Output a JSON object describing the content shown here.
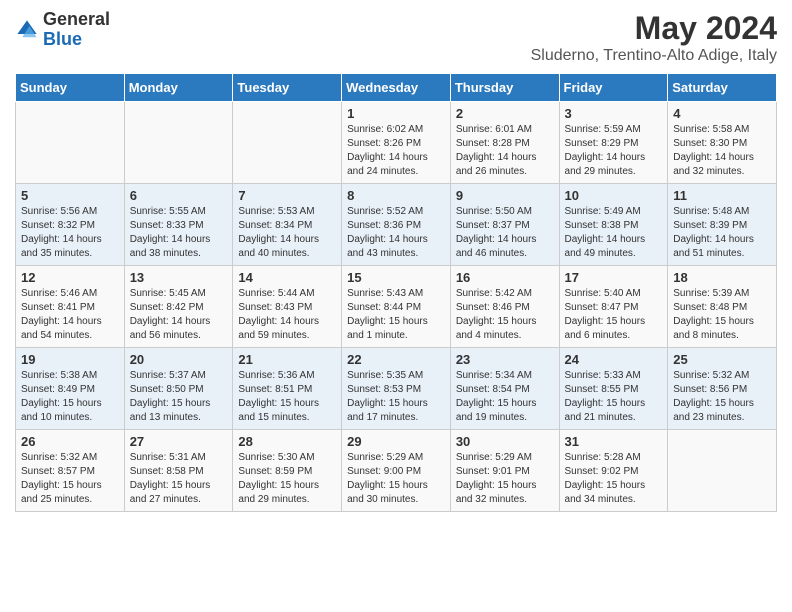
{
  "header": {
    "logo_general": "General",
    "logo_blue": "Blue",
    "month_year": "May 2024",
    "location": "Sluderno, Trentino-Alto Adige, Italy"
  },
  "days_of_week": [
    "Sunday",
    "Monday",
    "Tuesday",
    "Wednesday",
    "Thursday",
    "Friday",
    "Saturday"
  ],
  "weeks": [
    [
      {
        "day": "",
        "info": ""
      },
      {
        "day": "",
        "info": ""
      },
      {
        "day": "",
        "info": ""
      },
      {
        "day": "1",
        "info": "Sunrise: 6:02 AM\nSunset: 8:26 PM\nDaylight: 14 hours\nand 24 minutes."
      },
      {
        "day": "2",
        "info": "Sunrise: 6:01 AM\nSunset: 8:28 PM\nDaylight: 14 hours\nand 26 minutes."
      },
      {
        "day": "3",
        "info": "Sunrise: 5:59 AM\nSunset: 8:29 PM\nDaylight: 14 hours\nand 29 minutes."
      },
      {
        "day": "4",
        "info": "Sunrise: 5:58 AM\nSunset: 8:30 PM\nDaylight: 14 hours\nand 32 minutes."
      }
    ],
    [
      {
        "day": "5",
        "info": "Sunrise: 5:56 AM\nSunset: 8:32 PM\nDaylight: 14 hours\nand 35 minutes."
      },
      {
        "day": "6",
        "info": "Sunrise: 5:55 AM\nSunset: 8:33 PM\nDaylight: 14 hours\nand 38 minutes."
      },
      {
        "day": "7",
        "info": "Sunrise: 5:53 AM\nSunset: 8:34 PM\nDaylight: 14 hours\nand 40 minutes."
      },
      {
        "day": "8",
        "info": "Sunrise: 5:52 AM\nSunset: 8:36 PM\nDaylight: 14 hours\nand 43 minutes."
      },
      {
        "day": "9",
        "info": "Sunrise: 5:50 AM\nSunset: 8:37 PM\nDaylight: 14 hours\nand 46 minutes."
      },
      {
        "day": "10",
        "info": "Sunrise: 5:49 AM\nSunset: 8:38 PM\nDaylight: 14 hours\nand 49 minutes."
      },
      {
        "day": "11",
        "info": "Sunrise: 5:48 AM\nSunset: 8:39 PM\nDaylight: 14 hours\nand 51 minutes."
      }
    ],
    [
      {
        "day": "12",
        "info": "Sunrise: 5:46 AM\nSunset: 8:41 PM\nDaylight: 14 hours\nand 54 minutes."
      },
      {
        "day": "13",
        "info": "Sunrise: 5:45 AM\nSunset: 8:42 PM\nDaylight: 14 hours\nand 56 minutes."
      },
      {
        "day": "14",
        "info": "Sunrise: 5:44 AM\nSunset: 8:43 PM\nDaylight: 14 hours\nand 59 minutes."
      },
      {
        "day": "15",
        "info": "Sunrise: 5:43 AM\nSunset: 8:44 PM\nDaylight: 15 hours\nand 1 minute."
      },
      {
        "day": "16",
        "info": "Sunrise: 5:42 AM\nSunset: 8:46 PM\nDaylight: 15 hours\nand 4 minutes."
      },
      {
        "day": "17",
        "info": "Sunrise: 5:40 AM\nSunset: 8:47 PM\nDaylight: 15 hours\nand 6 minutes."
      },
      {
        "day": "18",
        "info": "Sunrise: 5:39 AM\nSunset: 8:48 PM\nDaylight: 15 hours\nand 8 minutes."
      }
    ],
    [
      {
        "day": "19",
        "info": "Sunrise: 5:38 AM\nSunset: 8:49 PM\nDaylight: 15 hours\nand 10 minutes."
      },
      {
        "day": "20",
        "info": "Sunrise: 5:37 AM\nSunset: 8:50 PM\nDaylight: 15 hours\nand 13 minutes."
      },
      {
        "day": "21",
        "info": "Sunrise: 5:36 AM\nSunset: 8:51 PM\nDaylight: 15 hours\nand 15 minutes."
      },
      {
        "day": "22",
        "info": "Sunrise: 5:35 AM\nSunset: 8:53 PM\nDaylight: 15 hours\nand 17 minutes."
      },
      {
        "day": "23",
        "info": "Sunrise: 5:34 AM\nSunset: 8:54 PM\nDaylight: 15 hours\nand 19 minutes."
      },
      {
        "day": "24",
        "info": "Sunrise: 5:33 AM\nSunset: 8:55 PM\nDaylight: 15 hours\nand 21 minutes."
      },
      {
        "day": "25",
        "info": "Sunrise: 5:32 AM\nSunset: 8:56 PM\nDaylight: 15 hours\nand 23 minutes."
      }
    ],
    [
      {
        "day": "26",
        "info": "Sunrise: 5:32 AM\nSunset: 8:57 PM\nDaylight: 15 hours\nand 25 minutes."
      },
      {
        "day": "27",
        "info": "Sunrise: 5:31 AM\nSunset: 8:58 PM\nDaylight: 15 hours\nand 27 minutes."
      },
      {
        "day": "28",
        "info": "Sunrise: 5:30 AM\nSunset: 8:59 PM\nDaylight: 15 hours\nand 29 minutes."
      },
      {
        "day": "29",
        "info": "Sunrise: 5:29 AM\nSunset: 9:00 PM\nDaylight: 15 hours\nand 30 minutes."
      },
      {
        "day": "30",
        "info": "Sunrise: 5:29 AM\nSunset: 9:01 PM\nDaylight: 15 hours\nand 32 minutes."
      },
      {
        "day": "31",
        "info": "Sunrise: 5:28 AM\nSunset: 9:02 PM\nDaylight: 15 hours\nand 34 minutes."
      },
      {
        "day": "",
        "info": ""
      }
    ]
  ]
}
